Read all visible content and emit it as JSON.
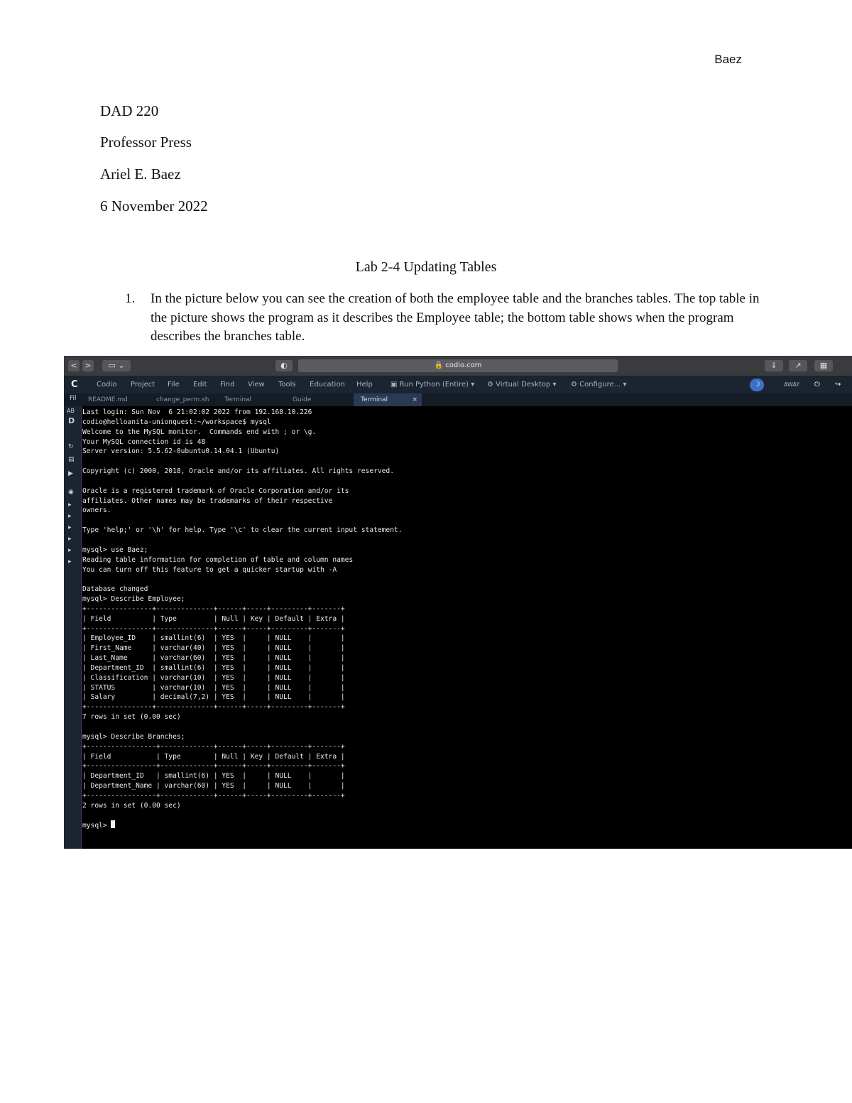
{
  "header": {
    "running_head": "Baez",
    "lines": [
      "DAD 220",
      "Professor Press",
      "Ariel E. Baez",
      "6 November 2022"
    ]
  },
  "title": "Lab 2-4 Updating Tables",
  "items": [
    {
      "number": "1.",
      "text": "In the picture below you can see the creation of both the employee table and the branches tables. The top table in the picture shows the program as it describes the Employee table; the bottom table shows when the program describes the branches table."
    }
  ],
  "screenshot": {
    "browser": {
      "url": "codio.com",
      "back": "<",
      "forward": ">"
    },
    "menu": {
      "logo": "C",
      "items": [
        "Codio",
        "Project",
        "File",
        "Edit",
        "Find",
        "View",
        "Tools",
        "Education",
        "Help"
      ],
      "run": "Run Python (Entire)",
      "desktop": "Virtual Desktop",
      "configure": "Configure...",
      "status": "AWAY"
    },
    "tabs": [
      "README.md",
      "change_perm.sh",
      "Terminal",
      "Guide",
      "Terminal"
    ],
    "tab_close": "×",
    "sidebar": {
      "label_top": "Fil",
      "label_ab": "AB",
      "label_d": "D"
    },
    "terminal": {
      "lines": [
        "Last login: Sun Nov  6 21:02:02 2022 from 192.168.10.226",
        "codio@helloanita-unionquest:~/workspace$ mysql",
        "Welcome to the MySQL monitor.  Commands end with ; or \\g.",
        "Your MySQL connection id is 48",
        "Server version: 5.5.62-0ubuntu0.14.04.1 (Ubuntu)",
        "",
        "Copyright (c) 2000, 2018, Oracle and/or its affiliates. All rights reserved.",
        "",
        "Oracle is a registered trademark of Oracle Corporation and/or its",
        "affiliates. Other names may be trademarks of their respective",
        "owners.",
        "",
        "Type 'help;' or '\\h' for help. Type '\\c' to clear the current input statement.",
        "",
        "mysql> use Baez;",
        "Reading table information for completion of table and column names",
        "You can turn off this feature to get a quicker startup with -A",
        "",
        "Database changed",
        "mysql> Describe Employee;",
        "+----------------+--------------+------+-----+---------+-------+",
        "| Field          | Type         | Null | Key | Default | Extra |",
        "+----------------+--------------+------+-----+---------+-------+",
        "| Employee_ID    | smallint(6)  | YES  |     | NULL    |       |",
        "| First_Name     | varchar(40)  | YES  |     | NULL    |       |",
        "| Last_Name      | varchar(60)  | YES  |     | NULL    |       |",
        "| Department_ID  | smallint(6)  | YES  |     | NULL    |       |",
        "| Classification | varchar(10)  | YES  |     | NULL    |       |",
        "| STATUS         | varchar(10)  | YES  |     | NULL    |       |",
        "| Salary         | decimal(7,2) | YES  |     | NULL    |       |",
        "+----------------+--------------+------+-----+---------+-------+",
        "7 rows in set (0.00 sec)",
        "",
        "mysql> Describe Branches;",
        "+-----------------+-------------+------+-----+---------+-------+",
        "| Field           | Type        | Null | Key | Default | Extra |",
        "+-----------------+-------------+------+-----+---------+-------+",
        "| Department_ID   | smallint(6) | YES  |     | NULL    |       |",
        "| Department_Name | varchar(60) | YES  |     | NULL    |       |",
        "+-----------------+-------------+------+-----+---------+-------+",
        "2 rows in set (0.00 sec)",
        ""
      ],
      "prompt": "mysql> "
    }
  }
}
